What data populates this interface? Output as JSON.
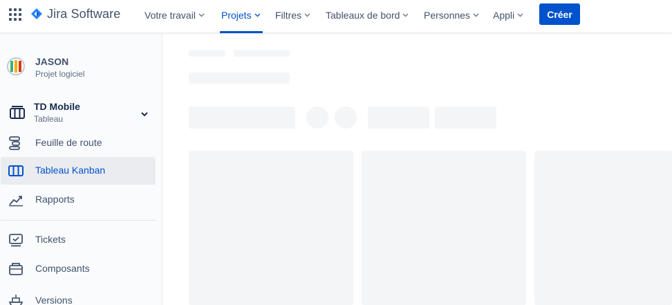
{
  "topnav": {
    "logo_text": "Jira Software",
    "items": [
      {
        "label": "Votre travail"
      },
      {
        "label": "Projets"
      },
      {
        "label": "Filtres"
      },
      {
        "label": "Tableaux de bord"
      },
      {
        "label": "Personnes"
      },
      {
        "label": "Appli"
      }
    ],
    "active_item": "Projets",
    "create_label": "Créer"
  },
  "sidebar": {
    "project": {
      "name": "JASON",
      "type": "Projet logiciel"
    },
    "board": {
      "name": "TD Mobile",
      "type": "Tableau"
    },
    "items": [
      {
        "label": "Feuille de route",
        "icon": "roadmap-icon"
      },
      {
        "label": "Tableau Kanban",
        "icon": "board-columns-icon",
        "selected": true
      },
      {
        "label": "Rapports",
        "icon": "chart-line-icon"
      },
      {
        "label": "Tickets",
        "icon": "issues-icon"
      },
      {
        "label": "Composants",
        "icon": "component-icon"
      },
      {
        "label": "Versions",
        "icon": "ship-icon"
      }
    ]
  },
  "colors": {
    "accent": "#0052cc",
    "text": "#42526e",
    "skeleton": "#f4f5f7",
    "sidebar_bg": "#fafbfc"
  },
  "main": {
    "state": "loading-skeleton"
  }
}
